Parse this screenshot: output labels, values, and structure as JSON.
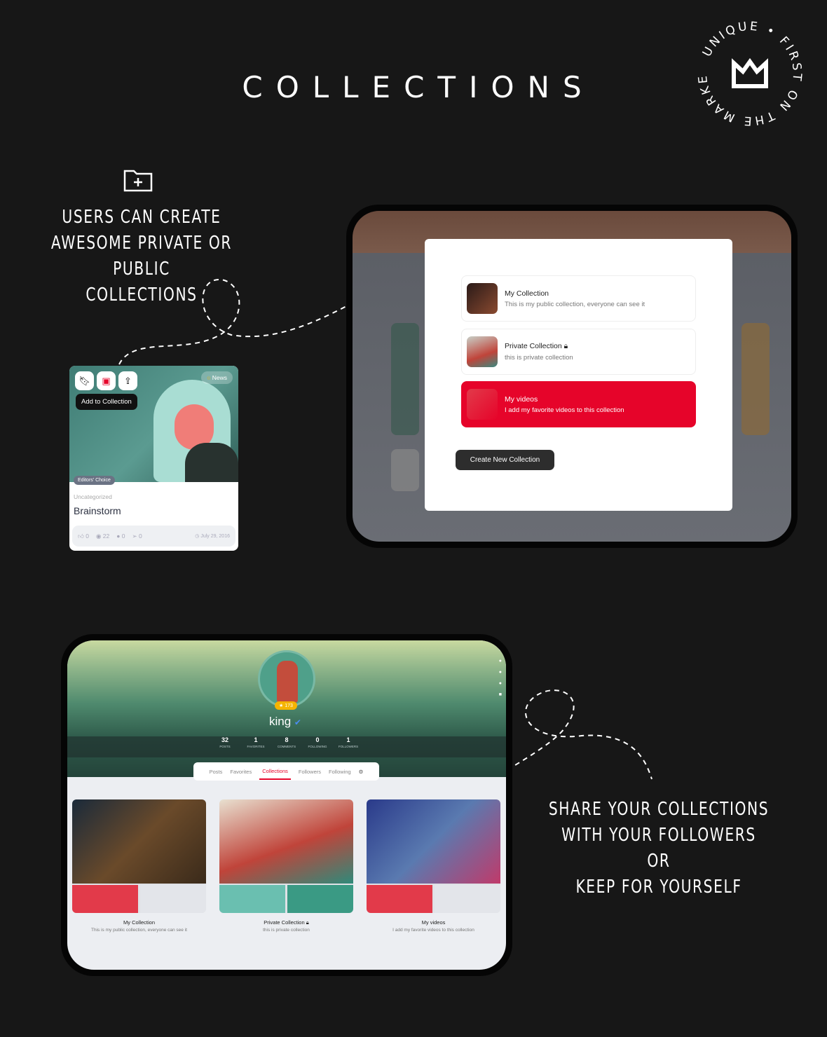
{
  "title": "COLLECTIONS",
  "seal": {
    "text": "UNIQUE • FIRST ON THE MARKET •",
    "icon": "crown-icon"
  },
  "left_text": [
    "USERS CAN CREATE",
    "AWESOME PRIVATE OR PUBLIC",
    "COLLECTIONS"
  ],
  "right_text": [
    "SHARE YOUR COLLECTIONS",
    "WITH YOUR FOLLOWERS",
    "OR",
    "KEEP FOR YOURSELF"
  ],
  "card": {
    "tooltip": "Add to Collection",
    "category_badge": "News",
    "editors_badge": "Editors' Choice",
    "category": "Uncategorized",
    "title": "Brainstorm",
    "likes": "0",
    "views": "22",
    "comments": "0",
    "shares": "0",
    "date": "July 29, 2016"
  },
  "modal": {
    "items": [
      {
        "name": "My Collection",
        "desc": "This is my public collection, everyone can see it",
        "locked": false,
        "selected": false
      },
      {
        "name": "Private Collection",
        "desc": "this is private collection",
        "locked": true,
        "selected": false
      },
      {
        "name": "My videos",
        "desc": "I add my favorite videos to this collection",
        "locked": false,
        "selected": true
      }
    ],
    "create_label": "Create New Collection"
  },
  "profile": {
    "username": "king",
    "verified": true,
    "points": "173",
    "stats": [
      {
        "value": "32",
        "label": "POSTS"
      },
      {
        "value": "1",
        "label": "FAVORITES"
      },
      {
        "value": "8",
        "label": "COMMENTS"
      },
      {
        "value": "0",
        "label": "FOLLOWING"
      },
      {
        "value": "1",
        "label": "FOLLOWERS"
      }
    ],
    "tabs": [
      "Posts",
      "Favorites",
      "Collections",
      "Followers",
      "Following"
    ],
    "active_tab": "Collections",
    "collections": [
      {
        "name": "My Collection",
        "desc": "This is my public collection, everyone can see it"
      },
      {
        "name": "Private Collection",
        "desc": "this is private collection"
      },
      {
        "name": "My videos",
        "desc": "I add my favorite videos to this collection"
      }
    ]
  },
  "colors": {
    "accent": "#e6042a",
    "background": "#171717"
  }
}
